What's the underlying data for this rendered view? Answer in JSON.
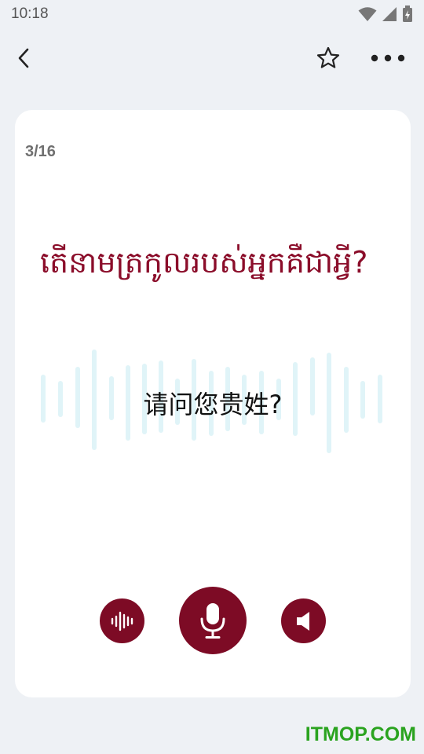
{
  "status_bar": {
    "time": "10:18",
    "icons": [
      "wifi-icon",
      "signal-icon",
      "battery-icon"
    ]
  },
  "app_bar": {
    "back_icon": "chevron-left-icon",
    "favorite_icon": "star-icon",
    "more_icon": "more-horizontal-icon"
  },
  "card": {
    "counter": "3/16",
    "source_text": "តើនាមត្រកូលរបស់អ្នកគឺជាអ្វី?",
    "translation": "请问您贵姓?"
  },
  "controls": {
    "waveform_icon": "audio-waveform-icon",
    "mic_icon": "microphone-icon",
    "speaker_icon": "speaker-icon"
  },
  "colors": {
    "accent": "#7d0b25",
    "text_accent": "#8b0d2a",
    "background": "#eef1f5",
    "wave": "#e0f4f8"
  },
  "watermark": "ITMOP.COM"
}
